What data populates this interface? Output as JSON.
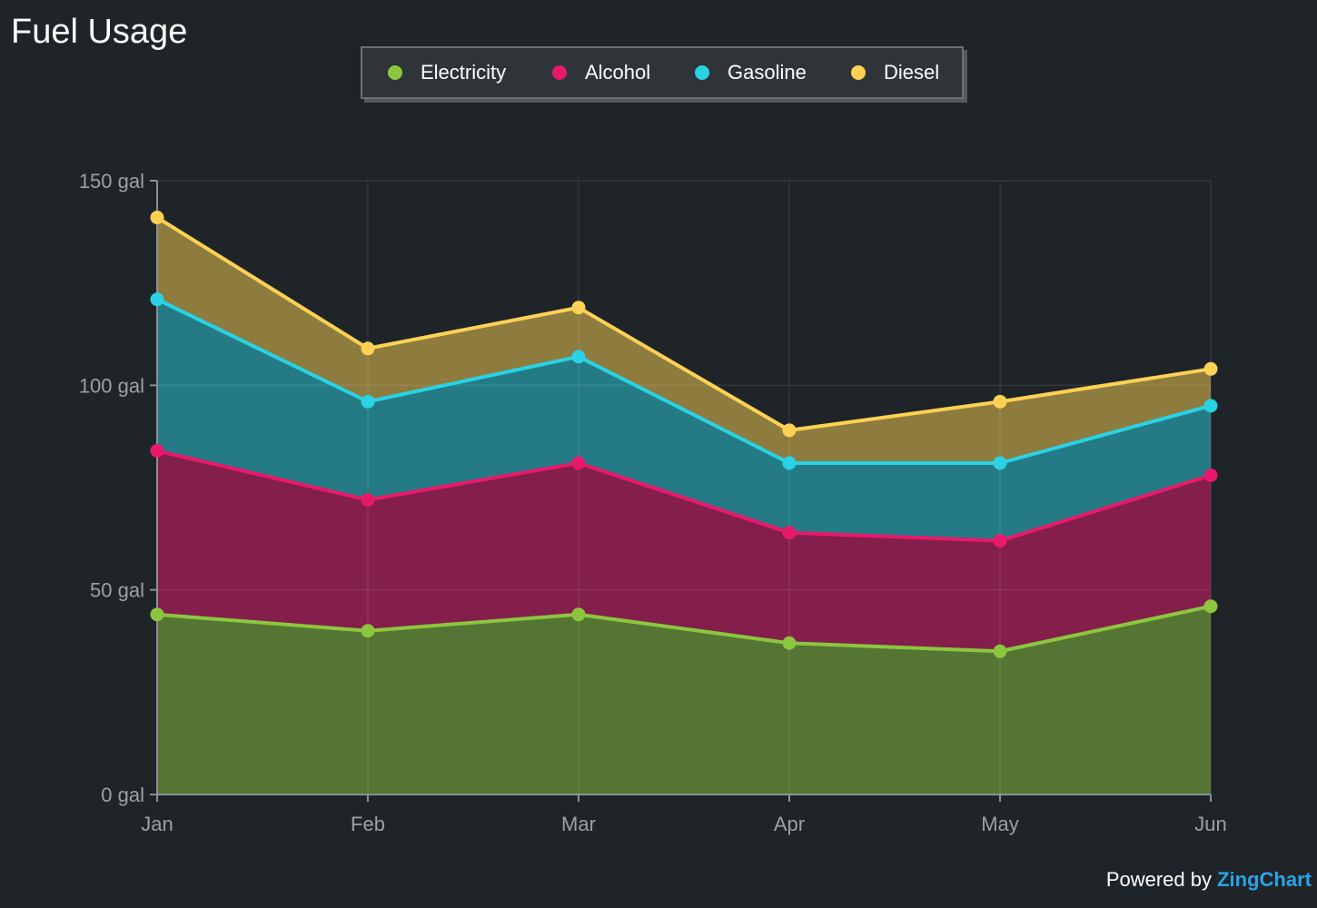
{
  "chart_data": {
    "type": "area",
    "stacked": true,
    "title": "Fuel Usage",
    "categories": [
      "Jan",
      "Feb",
      "Mar",
      "Apr",
      "May",
      "Jun"
    ],
    "ylim": [
      0,
      150
    ],
    "yticks": [
      0,
      50,
      100,
      150
    ],
    "y_unit_suffix": " gal",
    "grid": true,
    "legend_placement": "top-center",
    "series": [
      {
        "name": "Electricity",
        "color": "#8cc63f",
        "values": [
          44,
          40,
          44,
          37,
          35,
          46
        ]
      },
      {
        "name": "Alcohol",
        "color": "#e8196b",
        "values": [
          40,
          32,
          37,
          27,
          27,
          32
        ]
      },
      {
        "name": "Gasoline",
        "color": "#29d2e4",
        "values": [
          37,
          24,
          26,
          17,
          19,
          17
        ]
      },
      {
        "name": "Diesel",
        "color": "#fdd153",
        "values": [
          20,
          13,
          12,
          8,
          15,
          9
        ]
      }
    ]
  },
  "background_color": "#1f2428",
  "credit": {
    "prefix": "Powered by ",
    "brand": "ZingChart"
  }
}
